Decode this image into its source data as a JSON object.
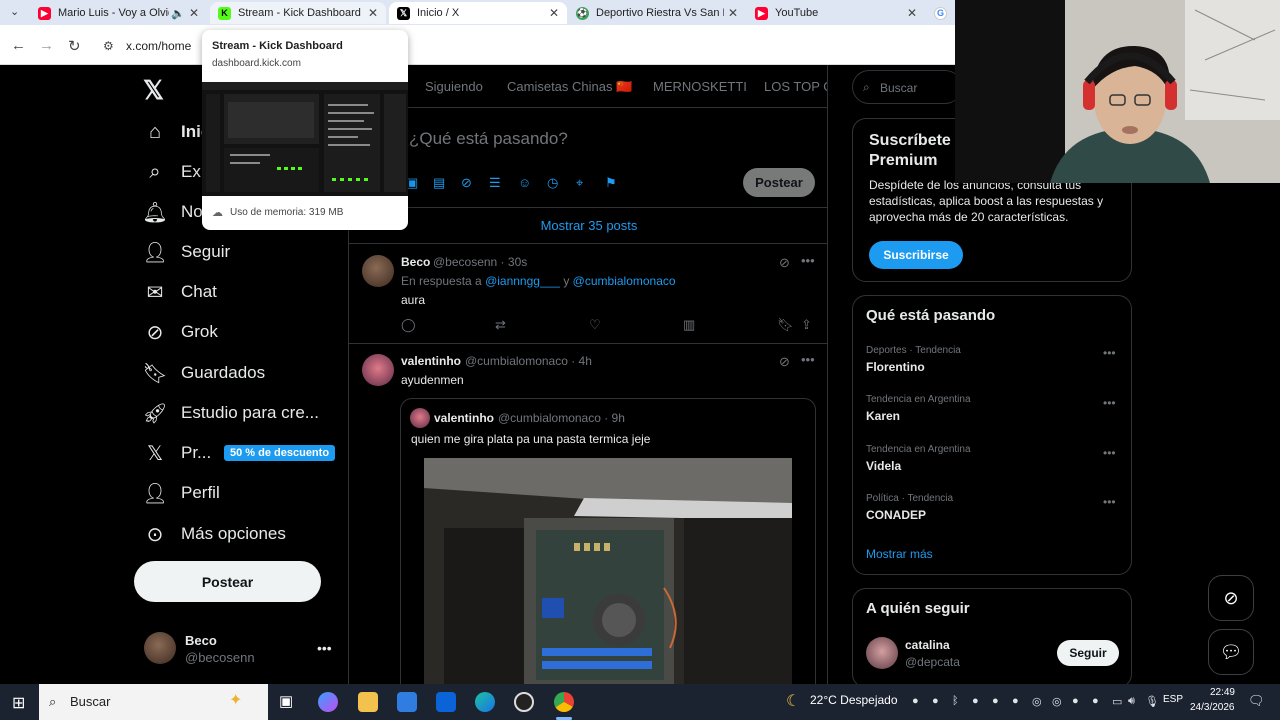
{
  "browser": {
    "tabs": [
      {
        "title": "Mario Luis - Voy a Olvidarte",
        "favicon_color": "#ff0033"
      },
      {
        "title": "Stream - Kick Dashboard",
        "favicon_color": "#53fc18"
      },
      {
        "title": "Inicio / X",
        "favicon_color": "#000000"
      },
      {
        "title": "Deportivo Riestra Vs San Lorenzo",
        "favicon_color": "#34a853"
      },
      {
        "title": "YouTube",
        "favicon_color": "#ff0033"
      }
    ],
    "url": "x.com/home",
    "hovercard": {
      "title": "Stream - Kick Dashboard",
      "domain": "dashboard.kick.com",
      "memory": "Uso de memoria: 319 MB"
    }
  },
  "sidebar": {
    "items": [
      {
        "label": "Inicio",
        "icon": "home-icon"
      },
      {
        "label": "Explorar",
        "icon": "search-icon"
      },
      {
        "label": "Notificaciones",
        "icon": "bell-icon"
      },
      {
        "label": "Seguir",
        "icon": "follow-icon"
      },
      {
        "label": "Chat",
        "icon": "mail-icon"
      },
      {
        "label": "Grok",
        "icon": "grok-icon"
      },
      {
        "label": "Guardados",
        "icon": "bookmark-icon"
      },
      {
        "label": "Estudio para cre...",
        "icon": "rocket-icon"
      },
      {
        "label": "Pr...",
        "icon": "x-icon"
      },
      {
        "label": "Perfil",
        "icon": "person-icon"
      },
      {
        "label": "Más opciones",
        "icon": "more-circle-icon"
      }
    ],
    "promo_badge": "50 % de descuento",
    "post_button": "Postear",
    "account": {
      "name": "Beco",
      "handle": "@becosenn"
    }
  },
  "timeline": {
    "tabs": [
      "Siguiendo",
      "Camisetas Chinas 🇨🇳",
      "MERNOSKETTI",
      "LOS TOP GI"
    ],
    "composer_placeholder": "¿Qué está pasando?",
    "compose_post_button": "Postear",
    "show_posts": "Mostrar 35 posts",
    "posts": [
      {
        "name": "Beco",
        "handle_time": "@becosenn · 30s",
        "reply_prefix": "En respuesta a",
        "reply_user1": "@iannngg___",
        "reply_and": "y",
        "reply_user2": "@cumbialomonaco",
        "text": "aura"
      },
      {
        "name": "valentinho",
        "handle_time": "@cumbialomonaco · 4h",
        "text": "ayudenmen",
        "quote": {
          "name": "valentinho",
          "handle_time": "@cumbialomonaco · 9h",
          "text": "quien me gira plata pa una pasta termica jeje"
        }
      }
    ]
  },
  "right": {
    "search_placeholder": "Buscar",
    "premium": {
      "title": "Suscríbete a Premium",
      "text": "Despídete de los anuncios, consulta tus estadísticas, aplica boost a las respuestas y aprovecha más de 20 características.",
      "button": "Suscribirse"
    },
    "trends": {
      "title": "Qué está pasando",
      "items": [
        {
          "category": "Deportes · Tendencia",
          "name": "Florentino"
        },
        {
          "category": "Tendencia en Argentina",
          "name": "Karen"
        },
        {
          "category": "Tendencia en Argentina",
          "name": "Videla"
        },
        {
          "category": "Política · Tendencia",
          "name": "CONADEP"
        }
      ],
      "more": "Mostrar más"
    },
    "follow": {
      "title": "A quién seguir",
      "name": "catalina",
      "handle": "@depcata",
      "button": "Seguir"
    }
  },
  "taskbar": {
    "search_placeholder": "Buscar",
    "weather": "22°C  Despejado",
    "lang": "ESP",
    "time": "22:49",
    "date": "24/3/2026"
  }
}
